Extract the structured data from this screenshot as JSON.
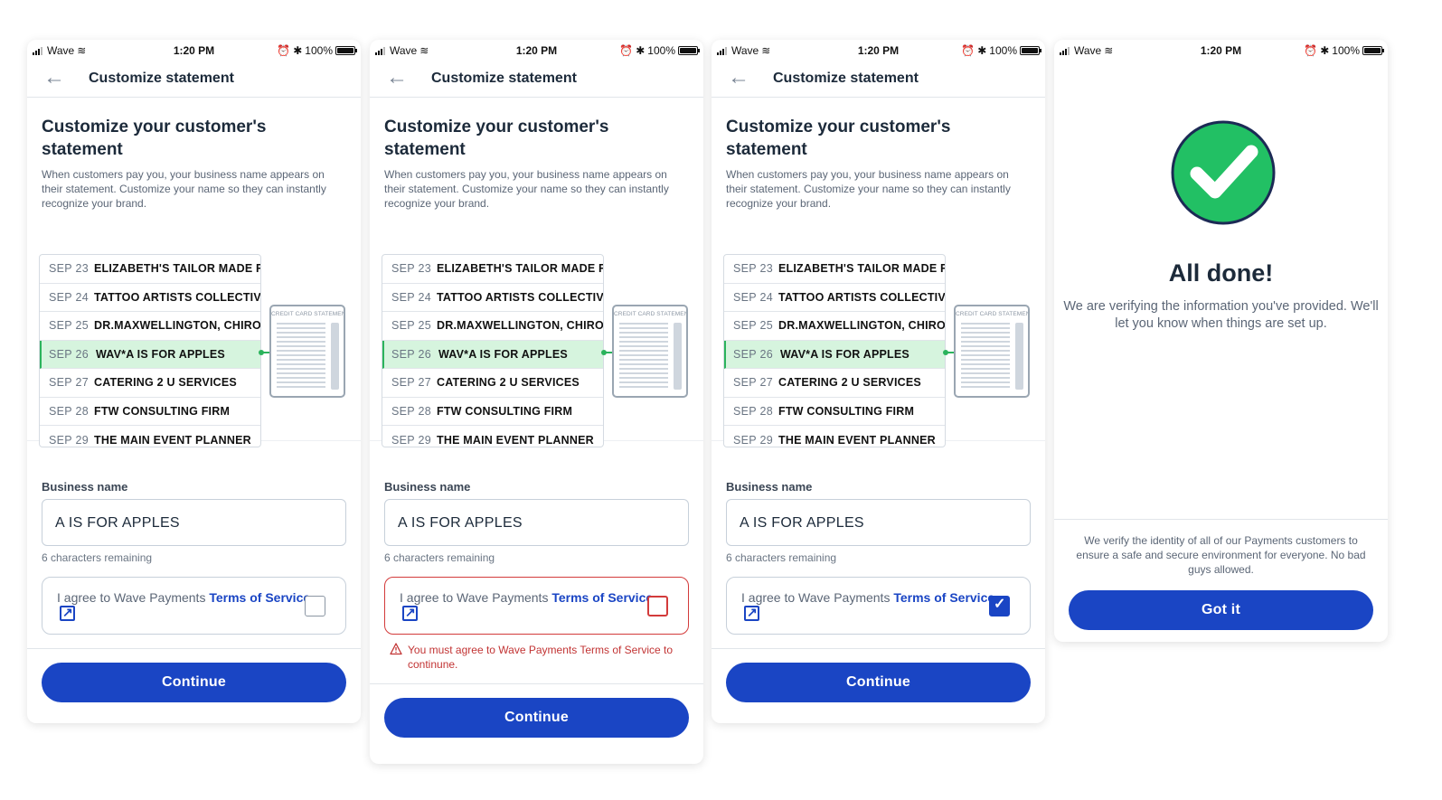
{
  "status": {
    "carrier": "Wave",
    "time": "1:20 PM",
    "battery": "100%"
  },
  "nav": {
    "title": "Customize statement"
  },
  "heading": "Customize your customer's statement",
  "description": "When customers pay you, your business name appears on their statement. Customize your name so they can instantly recognize your brand.",
  "statement": {
    "rows": [
      {
        "date": "SEP 23",
        "merchant": "ELIZABETH'S TAILOR MADE FA"
      },
      {
        "date": "SEP 24",
        "merchant": "TATTOO ARTISTS COLLECTIVE"
      },
      {
        "date": "SEP 25",
        "merchant": "DR.MAXWELLINGTON, CHIRO"
      },
      {
        "date": "SEP 26",
        "merchant": "WAV*A IS FOR APPLES"
      },
      {
        "date": "SEP 27",
        "merchant": "CATERING 2 U SERVICES"
      },
      {
        "date": "SEP 28",
        "merchant": "FTW CONSULTING FIRM"
      },
      {
        "date": "SEP 29",
        "merchant": "THE MAIN EVENT PLANNER"
      }
    ],
    "card_label": "CREDIT CARD STATEMENT"
  },
  "form": {
    "business_label": "Business name",
    "business_value": "A IS FOR APPLES",
    "remaining": "6 characters remaining",
    "terms_prefix": "I agree to Wave Payments ",
    "terms_link": "Terms of Service.",
    "error": "You must agree to Wave Payments Terms of Service to continune.",
    "continue": "Continue"
  },
  "done": {
    "title": "All done!",
    "message": "We are verifying the information you've provided. We'll let you know when things are set up.",
    "note": "We verify the identity of all of our Payments customers to ensure a safe and secure environment for everyone. No bad guys allowed.",
    "button": "Got it"
  },
  "colors": {
    "primary": "#1a45c4",
    "success": "#2bb35c",
    "error": "#d33b3b",
    "highlight": "#d6f4de"
  }
}
